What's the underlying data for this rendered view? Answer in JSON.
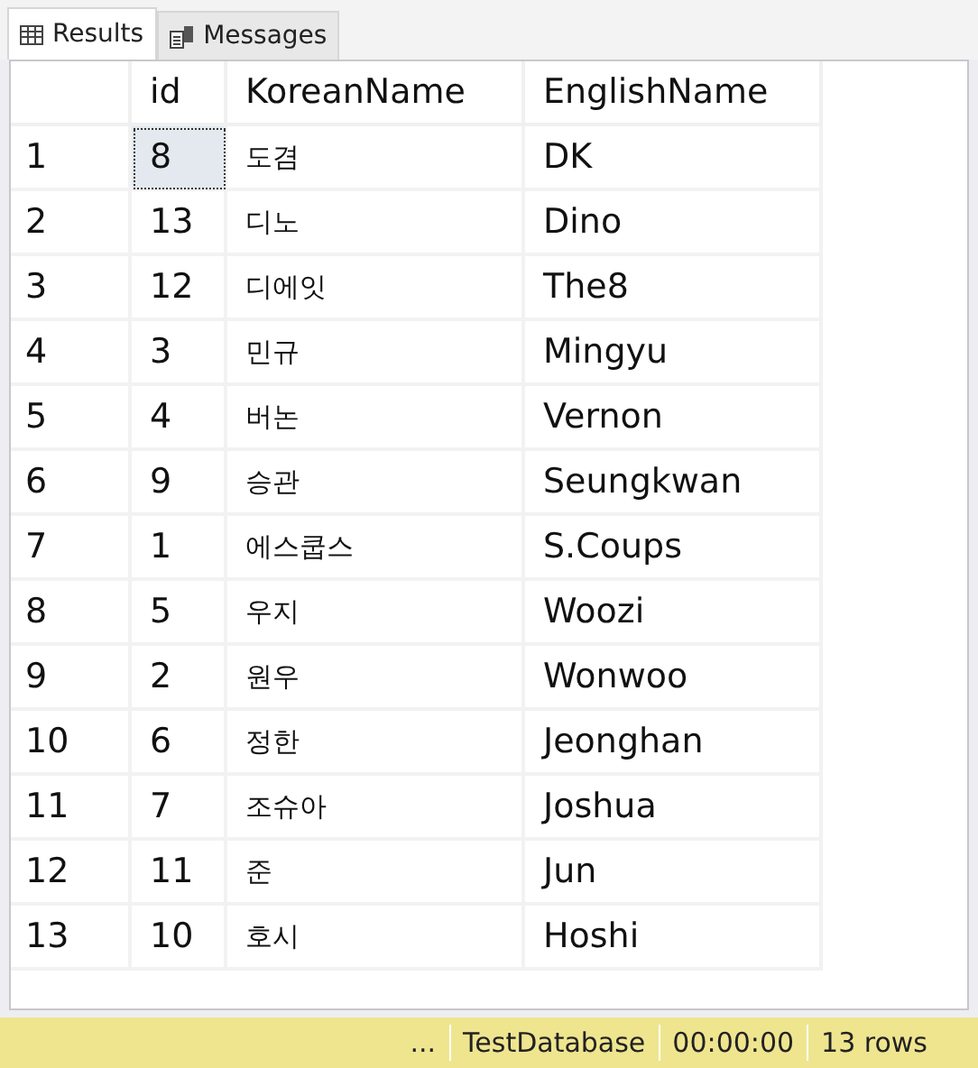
{
  "tabs": [
    {
      "label": "Results",
      "kind": "grid",
      "selected": true
    },
    {
      "label": "Messages",
      "kind": "messages",
      "selected": false
    }
  ],
  "table": {
    "columns": [
      "id",
      "KoreanName",
      "EnglishName"
    ],
    "rows": [
      {
        "number": "1",
        "cells": [
          {
            "text": "8",
            "selected": true
          },
          {
            "text": "도겸",
            "selected": false
          },
          {
            "text": "DK",
            "selected": false
          }
        ]
      },
      {
        "number": "2",
        "cells": [
          {
            "text": "13",
            "selected": false
          },
          {
            "text": "디노",
            "selected": false
          },
          {
            "text": "Dino",
            "selected": false
          }
        ]
      },
      {
        "number": "3",
        "cells": [
          {
            "text": "12",
            "selected": false
          },
          {
            "text": "디에잇",
            "selected": false
          },
          {
            "text": "The8",
            "selected": false
          }
        ]
      },
      {
        "number": "4",
        "cells": [
          {
            "text": "3",
            "selected": false
          },
          {
            "text": "민규",
            "selected": false
          },
          {
            "text": "Mingyu",
            "selected": false
          }
        ]
      },
      {
        "number": "5",
        "cells": [
          {
            "text": "4",
            "selected": false
          },
          {
            "text": "버논",
            "selected": false
          },
          {
            "text": "Vernon",
            "selected": false
          }
        ]
      },
      {
        "number": "6",
        "cells": [
          {
            "text": "9",
            "selected": false
          },
          {
            "text": "승관",
            "selected": false
          },
          {
            "text": "Seungkwan",
            "selected": false
          }
        ]
      },
      {
        "number": "7",
        "cells": [
          {
            "text": "1",
            "selected": false
          },
          {
            "text": "에스쿱스",
            "selected": false
          },
          {
            "text": "S.Coups",
            "selected": false
          }
        ]
      },
      {
        "number": "8",
        "cells": [
          {
            "text": "5",
            "selected": false
          },
          {
            "text": "우지",
            "selected": false
          },
          {
            "text": "Woozi",
            "selected": false
          }
        ]
      },
      {
        "number": "9",
        "cells": [
          {
            "text": "2",
            "selected": false
          },
          {
            "text": "원우",
            "selected": false
          },
          {
            "text": "Wonwoo",
            "selected": false
          }
        ]
      },
      {
        "number": "10",
        "cells": [
          {
            "text": "6",
            "selected": false
          },
          {
            "text": "정한",
            "selected": false
          },
          {
            "text": "Jeonghan",
            "selected": false
          }
        ]
      },
      {
        "number": "11",
        "cells": [
          {
            "text": "7",
            "selected": false
          },
          {
            "text": "조슈아",
            "selected": false
          },
          {
            "text": "Joshua",
            "selected": false
          }
        ]
      },
      {
        "number": "12",
        "cells": [
          {
            "text": "11",
            "selected": false
          },
          {
            "text": "준",
            "selected": false
          },
          {
            "text": "Jun",
            "selected": false
          }
        ]
      },
      {
        "number": "13",
        "cells": [
          {
            "text": "10",
            "selected": false
          },
          {
            "text": "호시",
            "selected": false
          },
          {
            "text": "Hoshi",
            "selected": false
          }
        ]
      }
    ]
  },
  "status_bar": {
    "items": [
      "...",
      "TestDatabase",
      "00:00:00",
      "13 rows"
    ]
  }
}
